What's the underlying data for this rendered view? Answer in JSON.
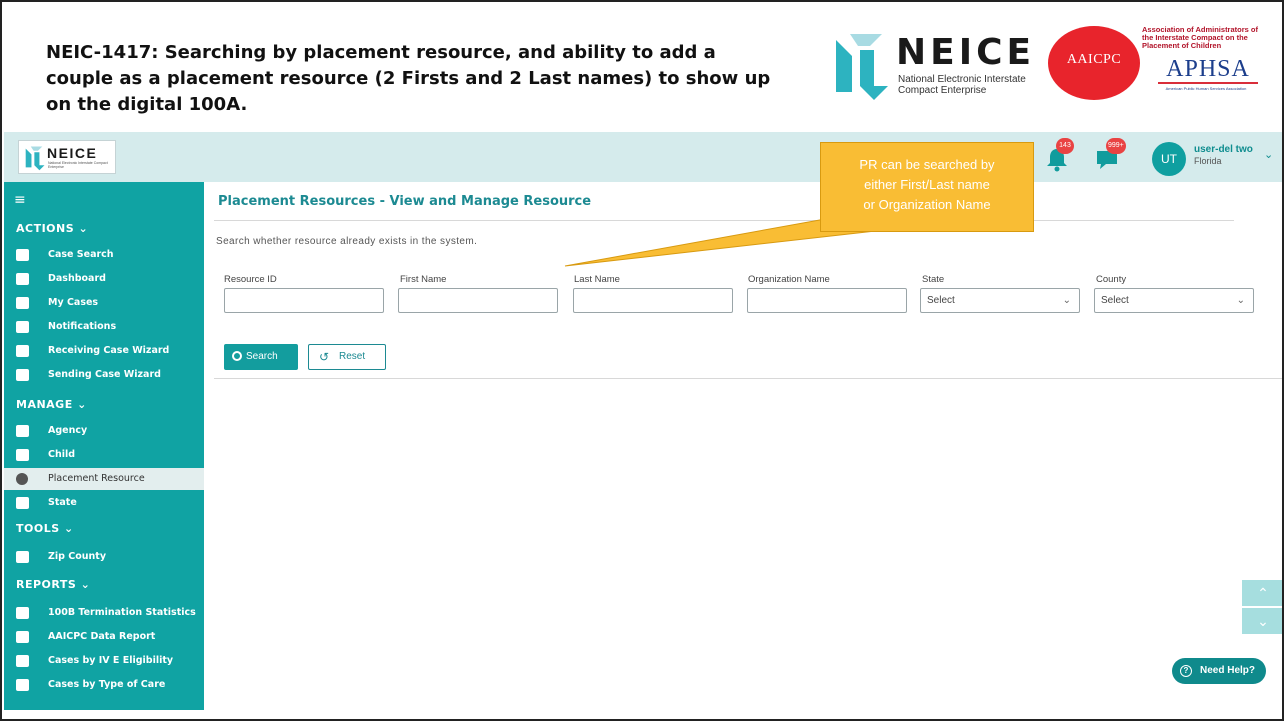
{
  "slide": {
    "title": "NEIC-1417: Searching by placement resource, and ability to add a couple as a placement resource (2 Firsts and 2 Last names) to show up on the digital 100A.",
    "neice_word": "NEICE",
    "neice_sub": "National Electronic Interstate Compact Enterprise",
    "aaicpc_label": "AAICPC",
    "assoc_text": "Association of Administrators of the Interstate Compact on the Placement of Children",
    "aphsa_label": "APHSA",
    "aphsa_sub": "American Public Human Services Association"
  },
  "topbar": {
    "logo_word": "NEICE",
    "logo_sub": "National Electronic Interstate Compact Enterprise",
    "notifications_count": "143",
    "messages_count": "999+",
    "avatar_initials": "UT",
    "user_name": "user-del two",
    "user_state": "Florida"
  },
  "sidebar": {
    "sections": {
      "actions": "ACTIONS",
      "manage": "MANAGE",
      "tools": "TOOLS",
      "reports": "REPORTS"
    },
    "actions": [
      "Case Search",
      "Dashboard",
      "My Cases",
      "Notifications",
      "Receiving Case Wizard",
      "Sending Case Wizard"
    ],
    "manage": [
      "Agency",
      "Child",
      "Placement Resource",
      "State"
    ],
    "tools": [
      "Zip County"
    ],
    "reports": [
      "100B Termination Statistics",
      "AAICPC Data Report",
      "Cases by IV E Eligibility",
      "Cases by Type of Care"
    ],
    "active_item": "Placement Resource"
  },
  "main": {
    "page_title": "Placement Resources - View and Manage Resource",
    "hint": "Search whether resource already exists in the system.",
    "fields": {
      "resource_id": "Resource ID",
      "first_name": "First Name",
      "last_name": "Last Name",
      "organization_name": "Organization Name",
      "state": "State",
      "county": "County"
    },
    "values": {
      "resource_id": "",
      "first_name": "",
      "last_name": "",
      "organization_name": ""
    },
    "state_selected": "Select",
    "county_selected": "Select",
    "search_label": "Search",
    "reset_label": "Reset"
  },
  "callout": {
    "text_line1": "PR can be searched by",
    "text_line2": "either First/Last name",
    "text_line3": "or Organization Name"
  },
  "help": {
    "label": "Need Help?"
  },
  "colors": {
    "teal": "#10a3a3",
    "topbar": "#d5ebec",
    "callout": "#f9bd34",
    "badge": "#e94343"
  }
}
